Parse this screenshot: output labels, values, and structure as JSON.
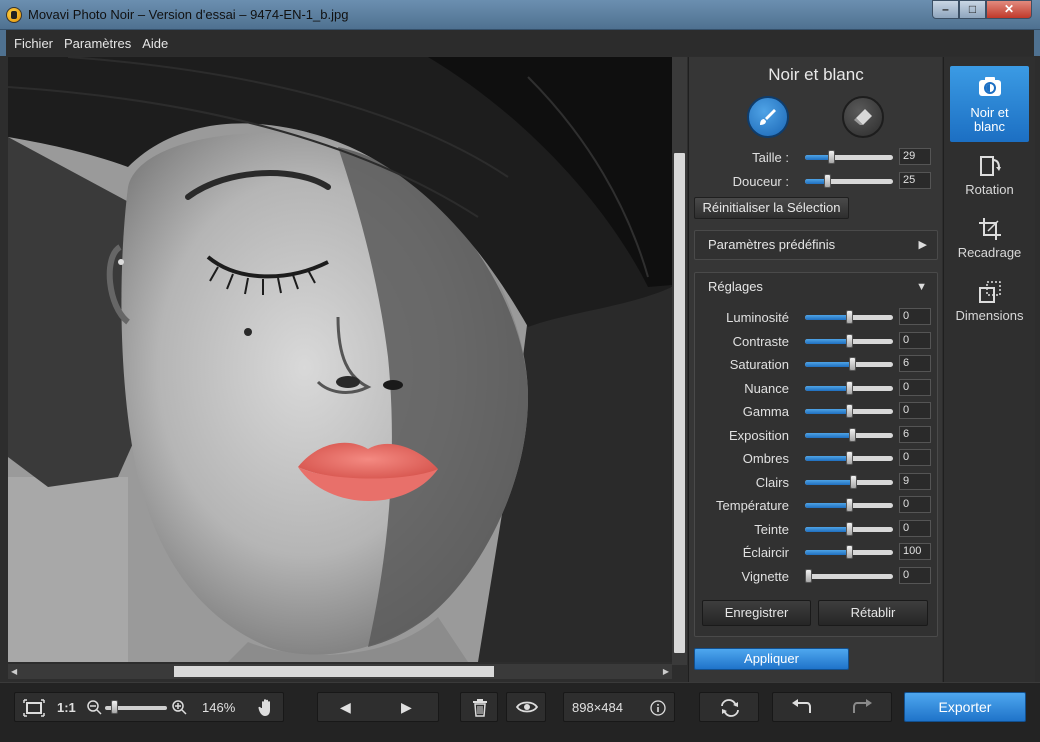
{
  "window": {
    "title": "Movavi Photo Noir – Version d'essai – 9474-EN-1_b.jpg",
    "controls": {
      "minimize": "–",
      "maximize": "□",
      "close": "✕"
    }
  },
  "menu": {
    "items": [
      "Fichier",
      "Paramètres",
      "Aide"
    ]
  },
  "panel": {
    "title": "Noir et blanc",
    "brush": [
      {
        "label": "Taille :",
        "value": "29",
        "level": 0.29
      },
      {
        "label": "Douceur :",
        "value": "25",
        "level": 0.25
      }
    ],
    "reset_label": "Réinitialiser la Sélection",
    "presets_label": "Paramètres prédéfinis",
    "settings_label": "Réglages",
    "adjustments": [
      {
        "label": "Luminosité",
        "value": "0",
        "level": 0.5
      },
      {
        "label": "Contraste",
        "value": "0",
        "level": 0.5
      },
      {
        "label": "Saturation",
        "value": "6",
        "level": 0.53
      },
      {
        "label": "Nuance",
        "value": "0",
        "level": 0.5
      },
      {
        "label": "Gamma",
        "value": "0",
        "level": 0.5
      },
      {
        "label": "Exposition",
        "value": "6",
        "level": 0.53
      },
      {
        "label": "Ombres",
        "value": "0",
        "level": 0.5
      },
      {
        "label": "Clairs",
        "value": "9",
        "level": 0.545
      },
      {
        "label": "Température",
        "value": "0",
        "level": 0.5
      },
      {
        "label": "Teinte",
        "value": "0",
        "level": 0.5
      },
      {
        "label": "Éclaircir",
        "value": "100",
        "level": 0.5
      },
      {
        "label": "Vignette",
        "value": "0",
        "level": 0.0
      }
    ],
    "save_label": "Enregistrer",
    "restore_label": "Rétablir",
    "apply_label": "Appliquer"
  },
  "sidebar": {
    "items": [
      {
        "label_line1": "Noir et",
        "label_line2": "blanc",
        "icon": "camera-icon",
        "active": true
      },
      {
        "label": "Rotation",
        "icon": "rotate-icon"
      },
      {
        "label": "Recadrage",
        "icon": "crop-icon"
      },
      {
        "label": "Dimensions",
        "icon": "resize-icon"
      }
    ]
  },
  "bottom": {
    "actual_size_label": "1:1",
    "zoom_level": "146%",
    "zoom_slider_level": 0.1,
    "dimensions": "898×484",
    "export_label": "Exporter"
  },
  "colors": {
    "accent": "#1f73c9",
    "panel_bg": "#363636",
    "lips": "#e8706a"
  }
}
